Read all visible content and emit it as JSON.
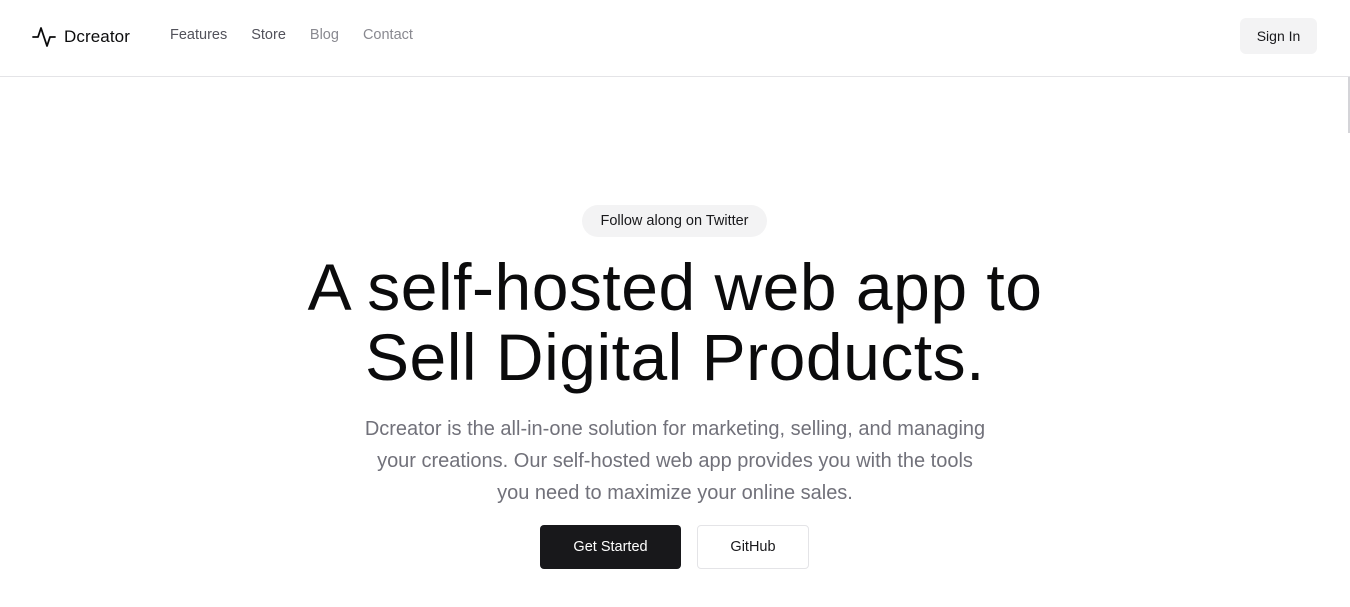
{
  "header": {
    "brand": {
      "name": "Dcreator",
      "icon": "activity-pulse-icon"
    },
    "nav": {
      "features": "Features",
      "store": "Store",
      "blog": "Blog",
      "contact": "Contact"
    },
    "sign_in_label": "Sign In"
  },
  "hero": {
    "announcement": "Follow along on Twitter",
    "headline": {
      "line1": "A self-hosted web app to",
      "line2": "Sell Digital Products."
    },
    "subheading": {
      "line1": "Dcreator is the all-in-one solution for marketing, selling, and managing",
      "line2": "your creations. Our self-hosted web app provides you with the tools",
      "line3": "you need to maximize your online sales."
    },
    "primary_cta": "Get Started",
    "secondary_cta": "GitHub"
  },
  "colors": {
    "background": "#ffffff",
    "text": "#0b0b0c",
    "muted_text": "#71717a",
    "button_dark": "#18181b",
    "button_light": "#f3f3f4",
    "border": "#e4e4e7"
  }
}
